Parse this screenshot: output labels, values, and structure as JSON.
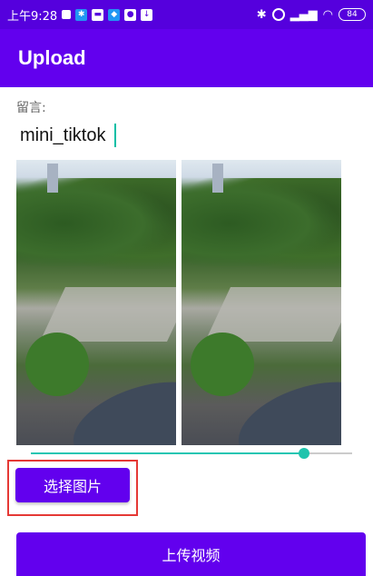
{
  "status_bar": {
    "time": "上午9:28",
    "battery": "84"
  },
  "app_bar": {
    "title": "Upload"
  },
  "comment": {
    "label": "留言:",
    "value": "mini_tiktok"
  },
  "slider": {
    "progress": 0.85
  },
  "buttons": {
    "select_images": "选择图片",
    "upload_video": "上传视频"
  },
  "colors": {
    "accent": "#6200ee",
    "status_bar": "#5500dd",
    "slider": "#26c6b2",
    "highlight": "#e53935"
  }
}
